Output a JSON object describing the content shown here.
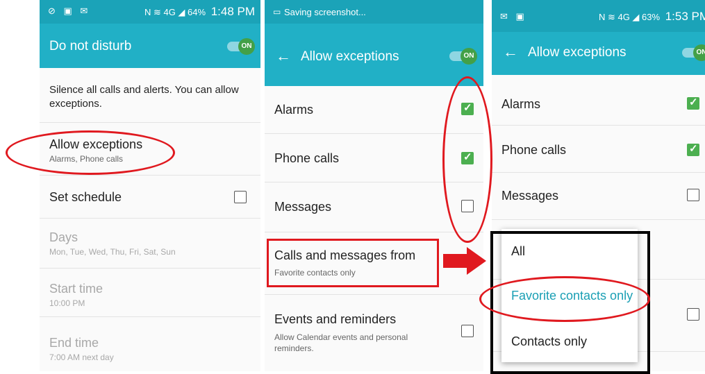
{
  "phone1": {
    "status": {
      "left_icons": "⊘ ▣ ✉",
      "right_icons": "N ≋ 4G ◢ 64%",
      "time": "1:48 PM"
    },
    "title": "Do not disturb",
    "toggle": "ON",
    "description": "Silence all calls and alerts. You can allow exceptions.",
    "items": [
      {
        "label": "Allow exceptions",
        "sub": "Alarms, Phone calls"
      },
      {
        "label": "Set schedule"
      },
      {
        "label": "Days",
        "sub": "Mon, Tue, Wed, Thu, Fri, Sat, Sun"
      },
      {
        "label": "Start time",
        "sub": "10:00 PM"
      },
      {
        "label": "End time",
        "sub": "7:00 AM next day"
      }
    ]
  },
  "phone2": {
    "status": {
      "text": "Saving screenshot..."
    },
    "title": "Allow exceptions",
    "toggle": "ON",
    "items": [
      {
        "label": "Alarms",
        "checked": true
      },
      {
        "label": "Phone calls",
        "checked": true
      },
      {
        "label": "Messages",
        "checked": false
      },
      {
        "label": "Calls and messages from",
        "sub": "Favorite contacts only"
      },
      {
        "label": "Events and reminders",
        "sub": "Allow Calendar events and personal reminders.",
        "checked": false
      }
    ]
  },
  "phone3": {
    "status": {
      "left_icons": "✉ ▣",
      "right_icons": "N ≋ 4G ◢ 63%",
      "time": "1:53 PM"
    },
    "title": "Allow exceptions",
    "toggle": "ON",
    "items": [
      {
        "label": "Alarms",
        "checked": true
      },
      {
        "label": "Phone calls",
        "checked": true
      },
      {
        "label": "Messages",
        "checked": false
      }
    ],
    "popup": {
      "options": [
        "All",
        "Favorite contacts only",
        "Contacts only"
      ],
      "selected": 1
    }
  },
  "colors": {
    "appbar": "#21b0c6",
    "statusbar": "#1ba3b8",
    "annotation": "#e0191f",
    "check": "#4caf50",
    "accent": "#1a9fb4"
  }
}
